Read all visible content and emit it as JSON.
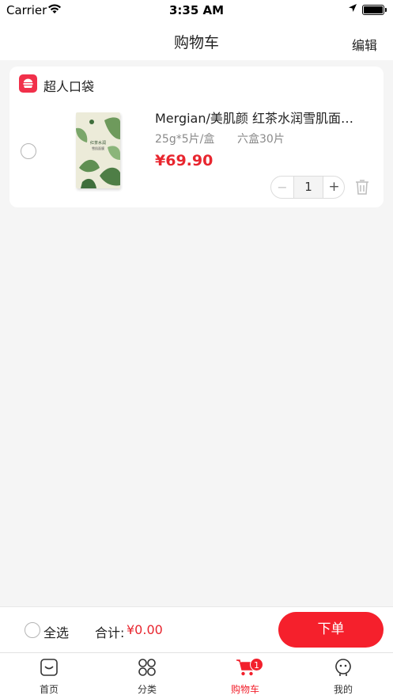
{
  "status_bar": {
    "carrier": "Carrier",
    "time": "3:35 AM"
  },
  "nav": {
    "title": "购物车",
    "edit_label": "编辑"
  },
  "cart": {
    "shop_name": "超人口袋",
    "items": [
      {
        "title": "Mergian/美肌颜 红茶水润雪肌面…",
        "spec_size": "25g*5片/盒",
        "spec_pack": "六盒30片",
        "price": "¥69.90",
        "quantity": "1",
        "selected": false,
        "image_text_1": "红茶水润",
        "image_text_2": "雪肌面膜"
      }
    ]
  },
  "checkout": {
    "select_all_label": "全选",
    "total_label": "合计:",
    "total_value": "¥0.00",
    "order_button": "下单"
  },
  "tabs": [
    {
      "label": "首页",
      "icon": "home-icon",
      "active": false
    },
    {
      "label": "分类",
      "icon": "category-icon",
      "active": false
    },
    {
      "label": "购物车",
      "icon": "cart-icon",
      "active": true,
      "badge": "1"
    },
    {
      "label": "我的",
      "icon": "profile-icon",
      "active": false
    }
  ],
  "colors": {
    "accent": "#f2202c",
    "price": "#e8262f",
    "background": "#f5f5f5"
  }
}
